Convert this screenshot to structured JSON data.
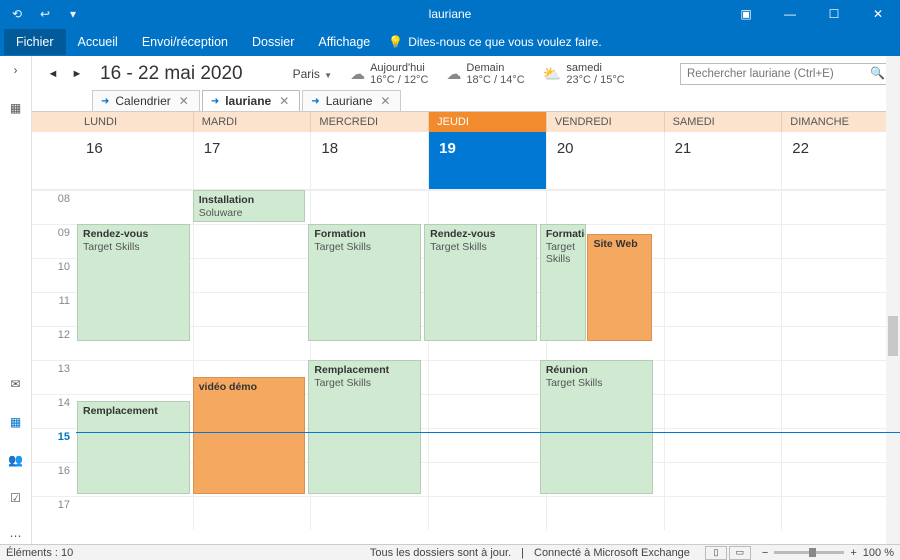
{
  "window": {
    "title": "lauriane"
  },
  "ribbon": {
    "file": "Fichier",
    "tabs": [
      "Accueil",
      "Envoi/réception",
      "Dossier",
      "Affichage"
    ],
    "tellme": "Dites-nous ce que vous voulez faire."
  },
  "header": {
    "range": "16 - 22 mai 2020",
    "city": "Paris",
    "weather": [
      {
        "day": "Aujourd'hui",
        "temp": "16°C / 12°C"
      },
      {
        "day": "Demain",
        "temp": "18°C / 14°C"
      },
      {
        "day": "samedi",
        "temp": "23°C / 15°C"
      }
    ],
    "search_placeholder": "Rechercher lauriane (Ctrl+E)"
  },
  "cal_tabs": [
    {
      "label": "Calendrier",
      "active": false
    },
    {
      "label": "lauriane",
      "active": true
    },
    {
      "label": "Lauriane",
      "active": false
    }
  ],
  "days": [
    {
      "name": "LUNDI",
      "num": "16",
      "today": false
    },
    {
      "name": "MARDI",
      "num": "17",
      "today": false
    },
    {
      "name": "MERCREDI",
      "num": "18",
      "today": false
    },
    {
      "name": "JEUDI",
      "num": "19",
      "today": true
    },
    {
      "name": "VENDREDI",
      "num": "20",
      "today": false
    },
    {
      "name": "SAMEDI",
      "num": "21",
      "today": false
    },
    {
      "name": "DIMANCHE",
      "num": "22",
      "today": false
    }
  ],
  "hours": [
    "08",
    "09",
    "10",
    "11",
    "12",
    "13",
    "14",
    "15",
    "16",
    "17"
  ],
  "current_hour": "15",
  "events": [
    {
      "title": "Installation",
      "loc": "Soluware",
      "color": "green",
      "day": 1,
      "start": 8,
      "end": 9
    },
    {
      "title": "Rendez-vous",
      "loc": "Target Skills",
      "color": "green",
      "day": 0,
      "start": 9,
      "end": 12.5
    },
    {
      "title": "Formation",
      "loc": "Target Skills",
      "color": "green",
      "day": 2,
      "start": 9,
      "end": 12.5
    },
    {
      "title": "Rendez-vous",
      "loc": "Target Skills",
      "color": "green",
      "day": 3,
      "start": 9,
      "end": 12.5
    },
    {
      "title": "Formation",
      "loc": "Target Skills",
      "color": "green",
      "day": 4,
      "start": 9,
      "end": 12.5,
      "narrow": "left"
    },
    {
      "title": "Site Web",
      "loc": "",
      "color": "orange",
      "day": 4,
      "start": 9.3,
      "end": 12.5,
      "narrow": "right"
    },
    {
      "title": "Remplacement",
      "loc": "Target Skills",
      "color": "green",
      "day": 2,
      "start": 13,
      "end": 17
    },
    {
      "title": "Réunion",
      "loc": "Target Skills",
      "color": "green",
      "day": 4,
      "start": 13,
      "end": 17
    },
    {
      "title": "vidéo démo",
      "loc": "",
      "color": "orange",
      "day": 1,
      "start": 13.5,
      "end": 17
    },
    {
      "title": "Remplacement",
      "loc": "",
      "color": "green",
      "day": 0,
      "start": 14.2,
      "end": 17
    }
  ],
  "status": {
    "items": "Éléments : 10",
    "sync": "Tous les dossiers sont à jour.",
    "conn": "Connecté à Microsoft Exchange",
    "zoom": "100 %"
  }
}
